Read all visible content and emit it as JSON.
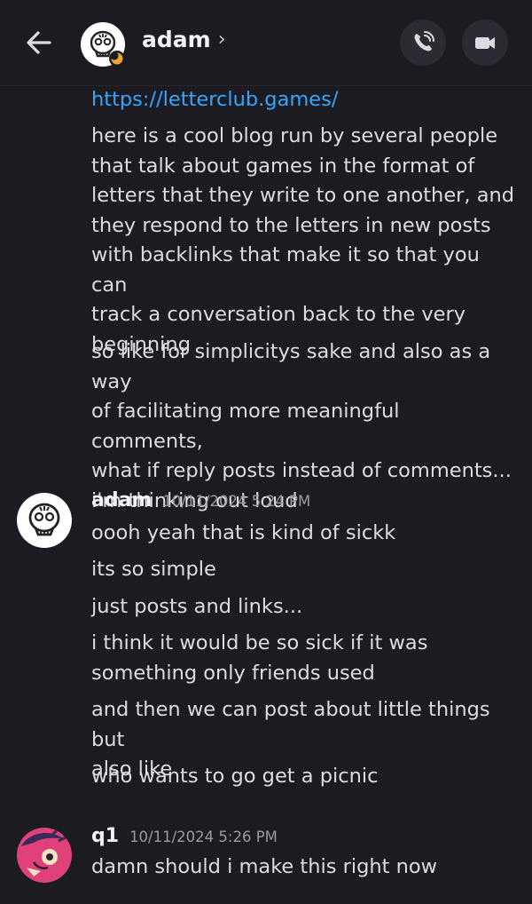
{
  "header": {
    "name": "adam",
    "chevron": "›"
  },
  "messages": {
    "group1": {
      "link": "https://letterclub.games/",
      "lines": [
        "here is a cool blog run by several people\nthat talk about games in the format of\nletters that they write to one another, and\nthey respond to the letters in new posts\nwith backlinks that make it so that you can\ntrack a conversation back to the very\nbeginning",
        "so like for simplicitys sake and also as a way\nof facilitating more meaningful comments,\nwhat if reply posts instead of comments...\ni'm thinking out loud"
      ]
    },
    "group2": {
      "author": "adam",
      "timestamp": "10/11/2024 5:24 PM",
      "lines": [
        "oooh yeah that is kind of sickk",
        "its so simple",
        "just posts and links...",
        "i think it would be so sick if it was\nsomething only friends used",
        "and then we can post about little things but\nalso like",
        "who wants to go get a picnic"
      ]
    },
    "group3": {
      "author": "q1",
      "timestamp": "10/11/2024 5:26 PM",
      "lines": [
        "damn should i make this right now"
      ]
    }
  },
  "icons": {
    "back": "arrow-left-icon",
    "call": "phone-icon",
    "video": "video-camera-icon",
    "status": "idle-moon-icon"
  },
  "colors": {
    "background": "#1b1b21",
    "link": "#35a7ff",
    "idle_status": "#f0a232",
    "avatar_q1": "#e0417a"
  }
}
